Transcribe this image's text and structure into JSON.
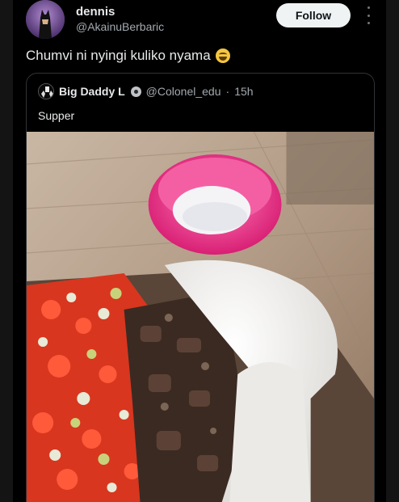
{
  "post": {
    "author": {
      "display_name": "dennis",
      "handle": "@AkainuBerbaric"
    },
    "follow_label": "Follow",
    "more_icon": "more-vertical-icon",
    "text": "Chumvi ni nyingi kuliko nyama",
    "emoji": "grinning-sweat-emoji"
  },
  "quoted_post": {
    "author": {
      "display_name": "Big Daddy L",
      "handle": "@Colonel_edu",
      "badge_icon": "disc-icon"
    },
    "separator": "·",
    "time": "15h",
    "text": "Supper"
  },
  "colors": {
    "background": "#000000",
    "follow_button": "#eff3f4",
    "secondary_text": "#a3a9ae",
    "border": "#2f3336"
  }
}
